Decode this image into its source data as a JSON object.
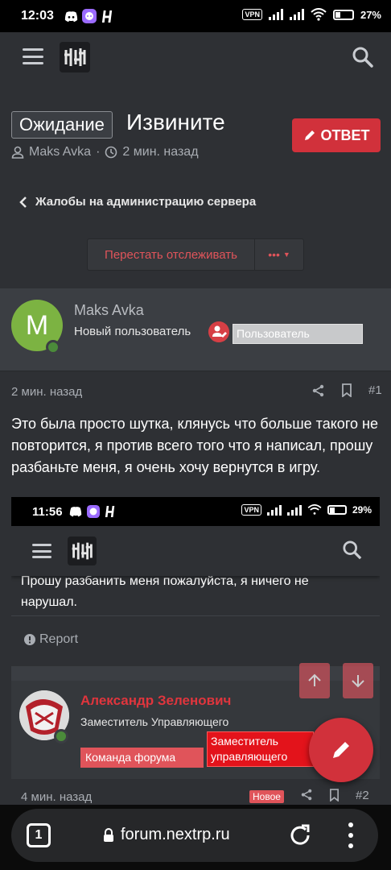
{
  "status_bar": {
    "time": "12:03",
    "vpn": "VPN",
    "battery": "27%"
  },
  "header": {
    "menu_icon": "hamburger-icon",
    "logo_icon": "site-logo",
    "search_icon": "search-icon"
  },
  "thread": {
    "prefix": "Ожидание",
    "title": "Извините",
    "author": "Maks Avka",
    "separator": "·",
    "time": "2 мин. назад",
    "reply_label": "ОТВЕТ",
    "breadcrumb": "Жалобы на администрацию сервера",
    "watch_label": "Перестать отслеживать",
    "more_label": "•••"
  },
  "post": {
    "avatar_letter": "M",
    "username": "Maks Avka",
    "user_title": "Новый пользователь",
    "user_group": "Пользователь",
    "time": "2 мин. назад",
    "number": "#1",
    "text": "Это была просто шутка, клянусь что больше такого не повторится, я против всего того что я написал, прошу разбаньте меня, я очень хочу вернутся в игру."
  },
  "embedded_screenshot": {
    "status_time": "11:56",
    "vpn": "VPN",
    "battery": "29%",
    "cut_text": "Прошу разбанить меня пожалуйста, я ничего не нарушал.",
    "report_label": "Report",
    "next_user": {
      "name": "Александр Зеленович",
      "title": "Заместитель Управляющего",
      "badge1": "Команда форума",
      "badge2": "Заместитель управляющего"
    },
    "next_time": "4 мин. назад",
    "new_label": "Новое",
    "next_number": "#2"
  },
  "browser": {
    "tab_count": "1",
    "url": "forum.nextrp.ru"
  },
  "colors": {
    "accent": "#d1313b",
    "background": "#2e3034",
    "panel": "#3b3e43"
  }
}
